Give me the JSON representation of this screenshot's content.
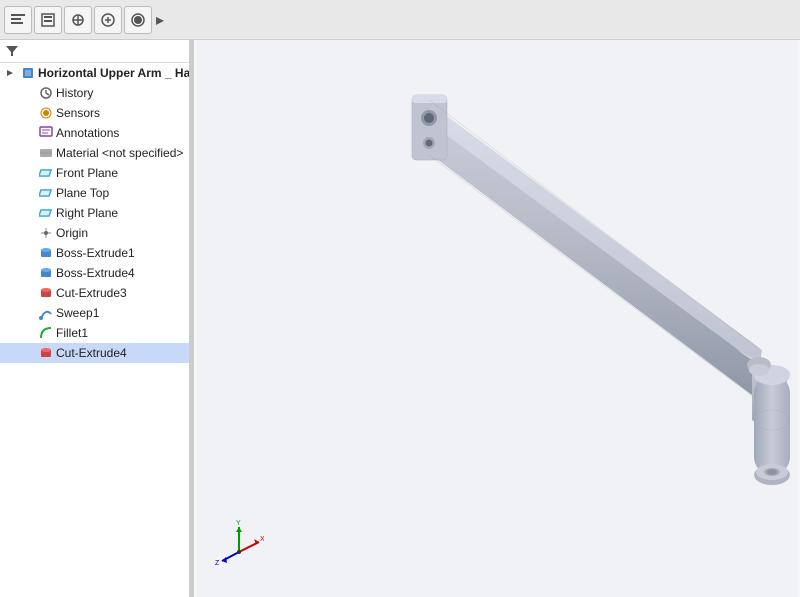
{
  "toolbar": {
    "more_label": "▸",
    "buttons": [
      {
        "name": "feature-manager-tab",
        "icon": "☰",
        "title": "FeatureManager"
      },
      {
        "name": "property-manager-tab",
        "icon": "⊞",
        "title": "PropertyManager"
      },
      {
        "name": "config-manager-tab",
        "icon": "❖",
        "title": "ConfigurationManager"
      },
      {
        "name": "dim-expert-tab",
        "icon": "⊕",
        "title": "DimXpertManager"
      },
      {
        "name": "display-manager-tab",
        "icon": "◉",
        "title": "DisplayManager"
      }
    ]
  },
  "sidebar": {
    "filter_icon": "▼",
    "items": [
      {
        "id": "root",
        "label": "Horizontal Upper Arm _ Han",
        "indent": 0,
        "icon": "part",
        "selected": false
      },
      {
        "id": "history",
        "label": "History",
        "indent": 1,
        "icon": "history",
        "selected": false
      },
      {
        "id": "sensors",
        "label": "Sensors",
        "indent": 1,
        "icon": "sensor",
        "selected": false
      },
      {
        "id": "annotations",
        "label": "Annotations",
        "indent": 1,
        "icon": "annotation",
        "selected": false
      },
      {
        "id": "material",
        "label": "Material <not specified>",
        "indent": 1,
        "icon": "material",
        "selected": false
      },
      {
        "id": "front-plane",
        "label": "Front Plane",
        "indent": 1,
        "icon": "plane",
        "selected": false
      },
      {
        "id": "top-plane",
        "label": "Plane Top",
        "indent": 1,
        "icon": "plane",
        "selected": false
      },
      {
        "id": "right-plane",
        "label": "Right Plane",
        "indent": 1,
        "icon": "plane",
        "selected": false
      },
      {
        "id": "origin",
        "label": "Origin",
        "indent": 1,
        "icon": "origin",
        "selected": false
      },
      {
        "id": "boss-extrude1",
        "label": "Boss-Extrude1",
        "indent": 1,
        "icon": "boss",
        "selected": false
      },
      {
        "id": "boss-extrude4",
        "label": "Boss-Extrude4",
        "indent": 1,
        "icon": "boss",
        "selected": false
      },
      {
        "id": "cut-extrude3",
        "label": "Cut-Extrude3",
        "indent": 1,
        "icon": "cut",
        "selected": false
      },
      {
        "id": "sweep1",
        "label": "Sweep1",
        "indent": 1,
        "icon": "sweep",
        "selected": false
      },
      {
        "id": "fillet1",
        "label": "Fillet1",
        "indent": 1,
        "icon": "fillet",
        "selected": false
      },
      {
        "id": "cut-extrude4",
        "label": "Cut-Extrude4",
        "indent": 1,
        "icon": "cut",
        "selected": true
      }
    ]
  },
  "viewport": {
    "background_color": "#f0f2f5"
  },
  "axes": {
    "x_color": "#ff0000",
    "y_color": "#00aa00",
    "z_color": "#0000ff"
  }
}
